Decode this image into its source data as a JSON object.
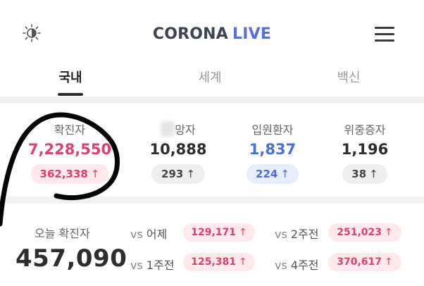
{
  "app": {
    "logo_word1": "CORONA",
    "logo_word2": "LIVE",
    "theme_icon": "brightness-icon",
    "menu_icon": "hamburger-menu-icon"
  },
  "tabs": [
    {
      "label": "국내",
      "active": true
    },
    {
      "label": "세계",
      "active": false
    },
    {
      "label": "백신",
      "active": false
    }
  ],
  "stats": [
    {
      "label": "확진자",
      "value": "7,228,550",
      "change": "362,338",
      "arrow": "↑",
      "value_color": "#e0406a"
    },
    {
      "label": "망자",
      "value": "10,888",
      "change": "293",
      "arrow": "↑",
      "value_color": "#2d2d2d"
    },
    {
      "label": "입원환자",
      "value": "1,837",
      "change": "224",
      "arrow": "↑",
      "value_color": "#4a6ee0"
    },
    {
      "label": "위중증자",
      "value": "1,196",
      "change": "38",
      "arrow": "↑",
      "value_color": "#2d2d2d"
    }
  ],
  "today": {
    "label": "오늘 확진자",
    "value": "457,090",
    "comparisons": [
      {
        "vs": "vs",
        "period": "어제",
        "value": "129,171",
        "arrow": "↑"
      },
      {
        "vs": "vs",
        "period": "2주전",
        "value": "251,023",
        "arrow": "↑"
      },
      {
        "vs": "vs",
        "period": "1주전",
        "value": "125,381",
        "arrow": "↑"
      },
      {
        "vs": "vs",
        "period": "4주전",
        "value": "370,617",
        "arrow": "↑"
      }
    ]
  },
  "colors": {
    "accent_blue": "#5a6ee0",
    "up_red": "#e0406a",
    "badge_pink": "#fde8ec",
    "badge_gray": "#eeeeee",
    "badge_blue": "#e7edfc"
  }
}
